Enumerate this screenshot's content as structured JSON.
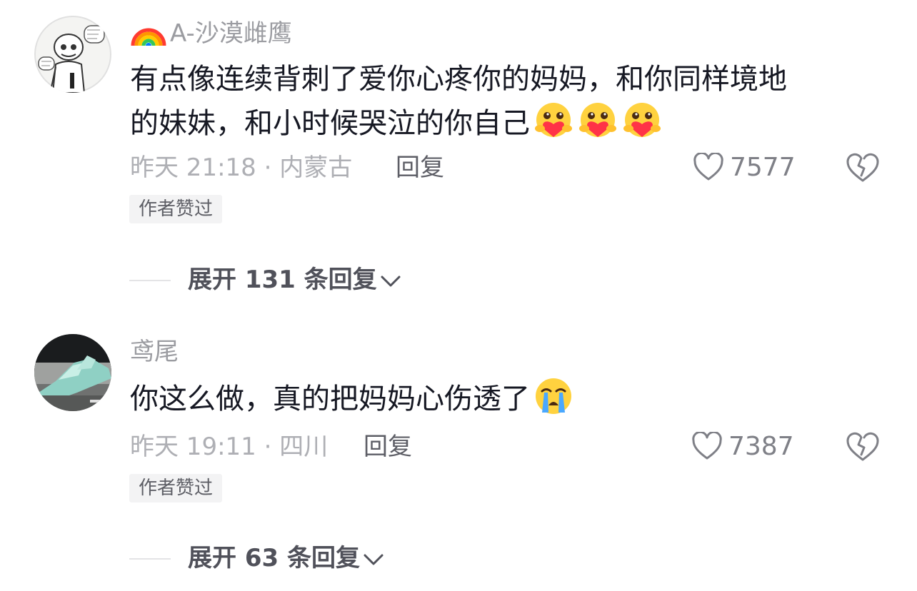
{
  "comments": [
    {
      "username": "A-沙漠雌鹰",
      "username_prefix_icon": "rainbow-icon",
      "text_line1": "有点像连续背刺了爱你心疼你的妈妈，和你同样境地",
      "text_line2": "的妹妹，和小时候哭泣的你自己",
      "emojis": [
        "hug-heart-emoji",
        "hug-heart-emoji",
        "hug-heart-emoji"
      ],
      "time_location": "昨天 21:18 · 内蒙古",
      "reply_label": "回复",
      "likes": "7577",
      "badge": "作者赞过",
      "expand_label": "展开 131 条回复"
    },
    {
      "username": "鸢尾",
      "text_line1": "你这么做，真的把妈妈心伤透了",
      "emojis": [
        "crying-emoji"
      ],
      "time_location": "昨天 19:11 · 四川",
      "reply_label": "回复",
      "likes": "7387",
      "badge": "作者赞过",
      "expand_label": "展开 63 条回复"
    }
  ],
  "colors": {
    "text_primary": "#161823",
    "text_secondary": "#aeafb4",
    "badge_bg": "#f3f3f4"
  }
}
